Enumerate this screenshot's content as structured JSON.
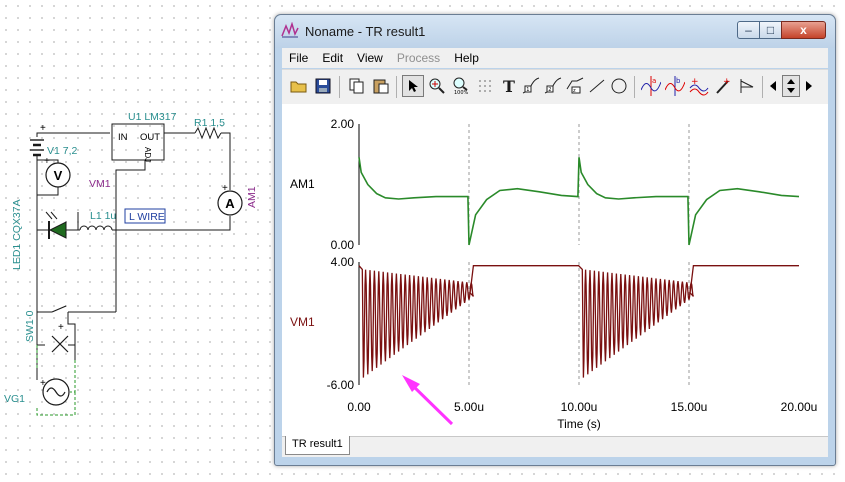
{
  "schematic": {
    "v1_label": "V1 7,2",
    "vm1_meter_label": "VM1",
    "u1_label": "U1 LM317",
    "u1_in": "IN",
    "u1_out": "OUT",
    "u1_adj": "ADJ",
    "r1_label": "R1 1,5",
    "am1_meter_label": "AM1",
    "l1_label": "L1 1u",
    "wire_label": "L WIRE",
    "led_label": "LED1 CQX37A",
    "sw_label": "SW1 0",
    "vg1_label": "VG1",
    "meter_v_symbol": "V",
    "meter_a_symbol": "A"
  },
  "window": {
    "title": "Noname - TR result1",
    "controls": {
      "minimize": "–",
      "maximize": "□",
      "close": "x"
    },
    "menu": [
      {
        "label": "File",
        "enabled": true
      },
      {
        "label": "Edit",
        "enabled": true
      },
      {
        "label": "View",
        "enabled": true
      },
      {
        "label": "Process",
        "enabled": false
      },
      {
        "label": "Help",
        "enabled": true
      }
    ],
    "toolbar_icons": [
      "open-folder-icon",
      "save-disk-icon",
      "copy-icon",
      "paste-icon",
      "pointer-icon",
      "zoom-in-icon",
      "zoom-100-icon",
      "grid-icon",
      "text-tool-icon",
      "curve-marker-1-icon",
      "curve-marker-2-icon",
      "curve-marker-3-icon",
      "line-tool-icon",
      "circle-tool-icon",
      "cursor-a-icon",
      "cursor-b-icon",
      "add-curve-icon",
      "pen-icon",
      "flag-icon",
      "scroll-left-icon",
      "scroll-updown-icon",
      "scroll-right-icon"
    ],
    "tab": "TR result1"
  },
  "chart_data": [
    {
      "type": "line",
      "title": "",
      "ylabel": "AM1",
      "ylim": [
        0.0,
        2.0
      ],
      "yticks": [
        "2.00",
        "0.00"
      ],
      "xlim": [
        0,
        20
      ],
      "x_unit": "u",
      "grid": "vertical dashed at 5u, 10u, 15u",
      "color": "#2a8a2a",
      "series": [
        {
          "name": "AM1",
          "x": [
            0,
            0.1,
            0.4,
            0.8,
            1.2,
            1.8,
            2.5,
            3.5,
            4.95,
            5.0,
            5.3,
            5.8,
            6.4,
            7.2,
            8.2,
            9.2,
            9.95,
            10.0,
            10.1,
            10.4,
            10.8,
            11.2,
            11.8,
            12.5,
            13.5,
            14.95,
            15.0,
            15.3,
            15.8,
            16.4,
            17.2,
            18.2,
            19.2,
            20.0
          ],
          "y": [
            1.45,
            1.2,
            1.0,
            0.85,
            0.78,
            0.76,
            0.78,
            0.8,
            0.8,
            0.0,
            0.5,
            0.75,
            0.9,
            0.93,
            0.88,
            0.82,
            0.8,
            1.45,
            1.2,
            1.0,
            0.85,
            0.78,
            0.76,
            0.78,
            0.8,
            0.8,
            0.0,
            0.5,
            0.75,
            0.9,
            0.93,
            0.88,
            0.82,
            0.8
          ]
        }
      ]
    },
    {
      "type": "line",
      "title": "",
      "ylabel": "VM1",
      "ylim": [
        -6.0,
        4.0
      ],
      "yticks": [
        "4.00",
        "-6.00"
      ],
      "xlim": [
        0,
        20
      ],
      "xticks": [
        "0.00",
        "5.00u",
        "10.00u",
        "15.00u",
        "20.00u"
      ],
      "xlabel": "Time (s)",
      "grid": "vertical dashed at 5u, 10u, 15u",
      "color": "#7a1010",
      "series": [
        {
          "name": "VM1",
          "description_points": {
            "pre_step_level": 3.7,
            "ringing_min_start": -5.4,
            "ringing_max": 3.4,
            "ringing_end_level": 1.5,
            "ringing_period_us": 0.2,
            "recovery_level": 3.7
          },
          "x": [
            0,
            0.2,
            0.3,
            4.95,
            5.0,
            5.3,
            9.95,
            10.0,
            10.2,
            10.3,
            14.95,
            15.0,
            15.3,
            20.0
          ],
          "y": [
            3.7,
            3.4,
            -5.4,
            1.5,
            1.5,
            3.7,
            3.7,
            3.7,
            3.4,
            -5.4,
            1.5,
            1.5,
            3.7,
            3.7
          ]
        }
      ]
    }
  ],
  "annotation": {
    "arrow_color": "#ff33ff"
  }
}
